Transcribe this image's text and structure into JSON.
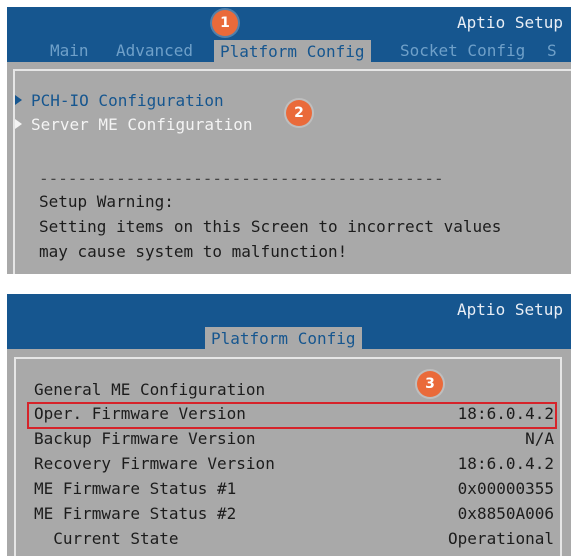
{
  "colors": {
    "titlebar_blue": "#16568f",
    "panel_gray": "#a9a9a9",
    "highlight_red": "#d6232a",
    "badge_orange": "#ea6a3a"
  },
  "screen1": {
    "title": "Aptio Setup",
    "tabs": [
      {
        "label": "Main",
        "active": false
      },
      {
        "label": "Advanced",
        "active": false
      },
      {
        "label": "Platform Config",
        "active": true
      },
      {
        "label": "Socket Config",
        "active": false
      },
      {
        "label": "S",
        "active": false
      }
    ],
    "menu_items": [
      {
        "label": "PCH-IO Configuration",
        "icon": "triangle-right-icon"
      },
      {
        "label": "Server ME Configuration",
        "icon": "triangle-right-icon"
      }
    ],
    "separator": "------------------------------------------",
    "warning_title": "Setup Warning:",
    "warning_lines": [
      "Setting items on this Screen to incorrect values",
      "may cause system to malfunction!"
    ]
  },
  "screen2": {
    "title": "Aptio Setup",
    "active_tab": "Platform Config",
    "section_title": "General ME Configuration",
    "rows": [
      {
        "label": "Oper. Firmware Version",
        "value": "18:6.0.4.2"
      },
      {
        "label": "Backup Firmware Version",
        "value": "N/A"
      },
      {
        "label": "Recovery Firmware Version",
        "value": "18:6.0.4.2"
      },
      {
        "label": "ME Firmware Status #1",
        "value": "0x00000355"
      },
      {
        "label": "ME Firmware Status #2",
        "value": "0x8850A006"
      },
      {
        "label": "  Current State",
        "value": "Operational"
      }
    ]
  },
  "badges": [
    "1",
    "2",
    "3"
  ]
}
